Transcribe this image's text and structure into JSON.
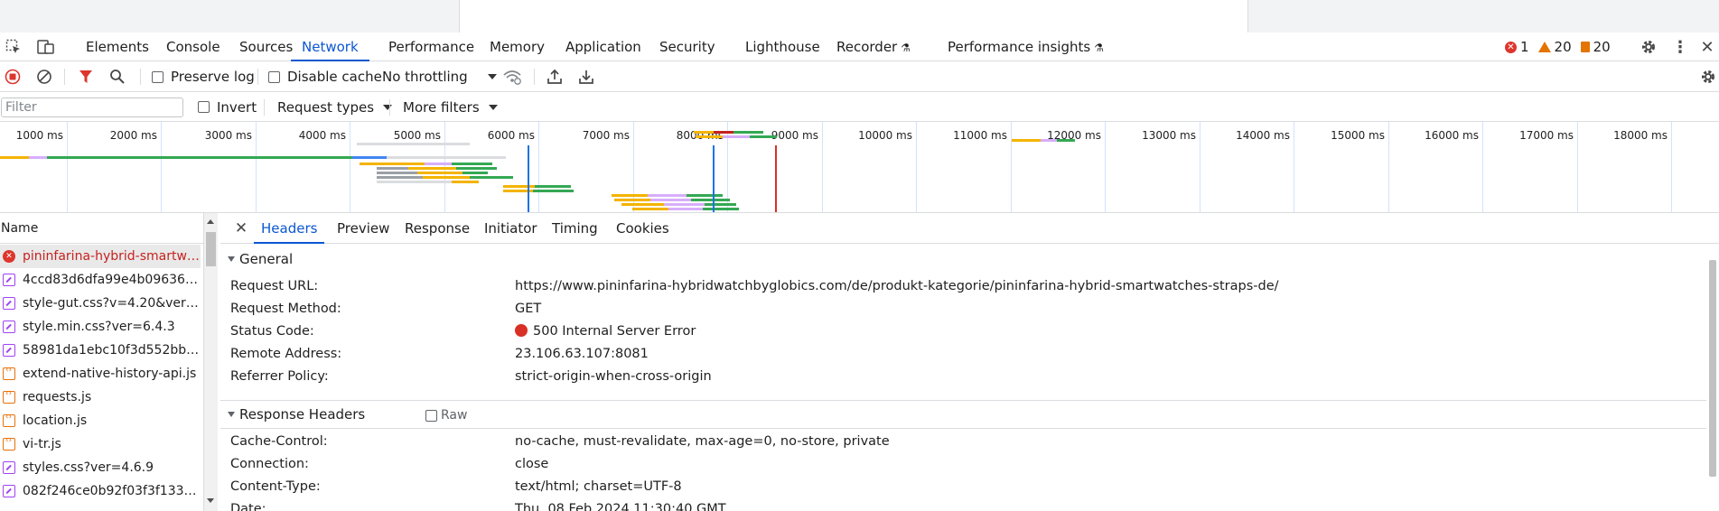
{
  "main_tabs": [
    "Elements",
    "Console",
    "Sources",
    "Network",
    "Performance",
    "Memory",
    "Application",
    "Security",
    "Lighthouse",
    "Recorder",
    "Performance insights"
  ],
  "counts": {
    "errors": "1",
    "warnings": "20",
    "issues": "20"
  },
  "toolbar": {
    "preserve_log": "Preserve log",
    "disable_cache": "Disable cache",
    "throttling": "No throttling"
  },
  "filterbar": {
    "filter_placeholder": "Filter",
    "invert": "Invert",
    "request_types": "Request types",
    "more_filters": "More filters"
  },
  "timeline_ticks": [
    "1000 ms",
    "2000 ms",
    "3000 ms",
    "4000 ms",
    "5000 ms",
    "6000 ms",
    "7000 ms",
    "8000 ms",
    "9000 ms",
    "10000 ms",
    "11000 ms",
    "12000 ms",
    "13000 ms",
    "14000 ms",
    "15000 ms",
    "16000 ms",
    "17000 ms",
    "18000 ms"
  ],
  "name_column": {
    "header": "Name",
    "requests": [
      {
        "name": "pininfarina-hybrid-smartwat...",
        "type": "err"
      },
      {
        "name": "4ccd83d6dfa99e4b096368c...",
        "type": "css"
      },
      {
        "name": "style-gut.css?v=4.20&ver=2...",
        "type": "css"
      },
      {
        "name": "style.min.css?ver=6.4.3",
        "type": "css"
      },
      {
        "name": "58981da1ebc10f3d552bb31...",
        "type": "css"
      },
      {
        "name": "extend-native-history-api.js",
        "type": "js"
      },
      {
        "name": "requests.js",
        "type": "js"
      },
      {
        "name": "location.js",
        "type": "js"
      },
      {
        "name": "vi-tr.js",
        "type": "js"
      },
      {
        "name": "styles.css?ver=4.6.9",
        "type": "css"
      },
      {
        "name": "082f246ce0b92f03f3f13333f...",
        "type": "css"
      }
    ]
  },
  "detail_tabs": [
    "Headers",
    "Preview",
    "Response",
    "Initiator",
    "Timing",
    "Cookies"
  ],
  "general": {
    "title": "General",
    "rows": [
      {
        "key": "Request URL:",
        "value": "https://www.pininfarina-hybridwatchbyglobics.com/de/produkt-kategorie/pininfarina-hybrid-smartwatches-straps-de/"
      },
      {
        "key": "Request Method:",
        "value": "GET"
      },
      {
        "key": "Status Code:",
        "value": "500 Internal Server Error"
      },
      {
        "key": "Remote Address:",
        "value": "23.106.63.107:8081"
      },
      {
        "key": "Referrer Policy:",
        "value": "strict-origin-when-cross-origin"
      }
    ]
  },
  "response_headers": {
    "title": "Response Headers",
    "raw_label": "Raw",
    "rows": [
      {
        "key": "Cache-Control:",
        "value": "no-cache, must-revalidate, max-age=0, no-store, private"
      },
      {
        "key": "Connection:",
        "value": "close"
      },
      {
        "key": "Content-Type:",
        "value": "text/html; charset=UTF-8"
      },
      {
        "key": "Date:",
        "value": "Thu, 08 Feb 2024 11:30:40 GMT"
      }
    ]
  },
  "colors": {
    "accent": "#0b57d0",
    "error": "#dc362e",
    "warning": "#e37400"
  }
}
